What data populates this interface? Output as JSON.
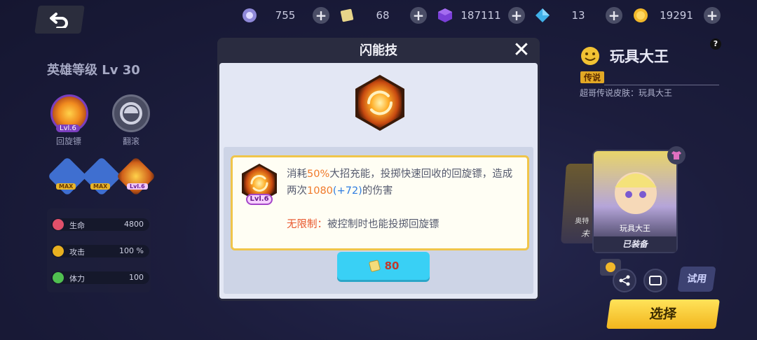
{
  "topbar": {
    "resources": [
      {
        "icon": "energy-orb-icon",
        "value": "755"
      },
      {
        "icon": "ticket-card-icon",
        "value": "68"
      },
      {
        "icon": "purple-cube-icon",
        "value": "187111"
      },
      {
        "icon": "blue-diamond-icon",
        "value": "13"
      },
      {
        "icon": "gold-coin-icon",
        "value": "19291"
      }
    ],
    "plus": "+"
  },
  "left": {
    "hero_level": "英雄等级 Lv 30",
    "skill1_label": "回旋镖",
    "skill1_level": "Lvl.6",
    "skill2_label": "翻滚",
    "mini_tags": [
      "MAX",
      "MAX",
      "Lvl.6"
    ],
    "stats": [
      {
        "name": "生命",
        "value": "4800",
        "color": "#e0506a"
      },
      {
        "name": "攻击",
        "value": "100 %",
        "color": "#e8b020"
      },
      {
        "name": "体力",
        "value": "100",
        "color": "#50c050"
      }
    ]
  },
  "right": {
    "skin_name": "玩具大王",
    "legend_tag": "传说",
    "skin_desc": "超哥传说皮肤：玩具大王",
    "help": "?",
    "back_card_name": "奥特",
    "back_card_status": "未",
    "card_name": "玩具大王",
    "card_status": "已装备",
    "try_label": "试用",
    "select_label": "选择"
  },
  "modal": {
    "title": "闪能技",
    "close": "✕",
    "level": "Lvl.6",
    "desc_1": "消耗",
    "desc_pct": "50%",
    "desc_2": "大招充能，投掷快速回收的回旋镖，造成两次",
    "desc_dmg": "1080",
    "desc_bonus": "(+72)",
    "desc_3": "的伤害",
    "unlimited_key": "无限制：",
    "unlimited_text": "被控制时也能投掷回旋镖",
    "cost": "80"
  },
  "colors": {
    "accent_orange": "#f07a2a",
    "accent_blue": "#2f7de0",
    "button_cyan": "#39d0f5",
    "select_yellow": "#f2b51d"
  }
}
